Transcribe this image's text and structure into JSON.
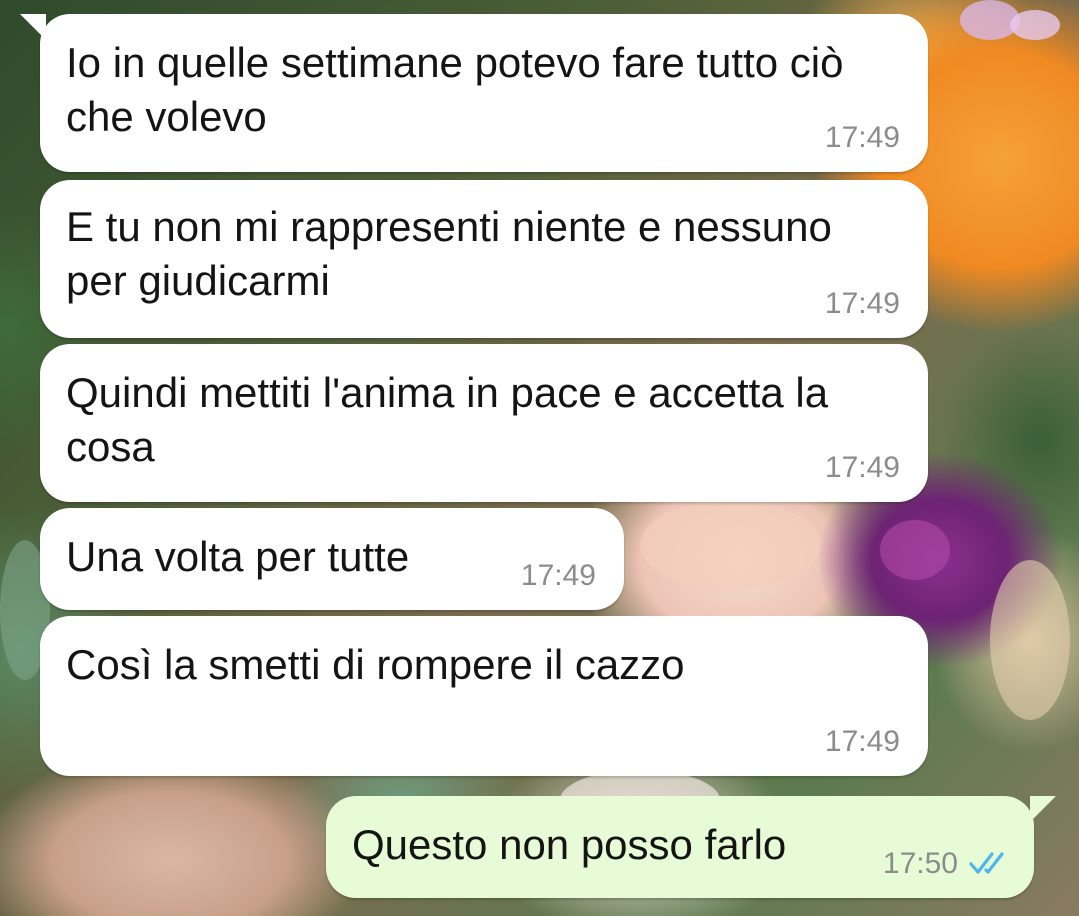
{
  "colors": {
    "incoming_bubble": "#ffffff",
    "outgoing_bubble": "#e6fbd6",
    "message_text": "#141414",
    "timestamp_text": "#8c8c8c",
    "read_ticks": "#4fb6ec"
  },
  "messages": [
    {
      "direction": "incoming",
      "text": "Io in quelle settimane potevo fare tutto ciò che volevo",
      "time": "17:49"
    },
    {
      "direction": "incoming",
      "text": "E tu non mi rappresenti niente e nessuno per giudicarmi",
      "time": "17:49"
    },
    {
      "direction": "incoming",
      "text": "Quindi mettiti l'anima in pace e accetta la cosa",
      "time": "17:49"
    },
    {
      "direction": "incoming",
      "text": "Una volta per tutte",
      "time": "17:49"
    },
    {
      "direction": "incoming",
      "text": "Così la smetti di rompere il cazzo",
      "time": "17:49"
    },
    {
      "direction": "outgoing",
      "text": "Questo non posso farlo",
      "time": "17:50",
      "status_icon": "double-check-read-icon"
    }
  ]
}
